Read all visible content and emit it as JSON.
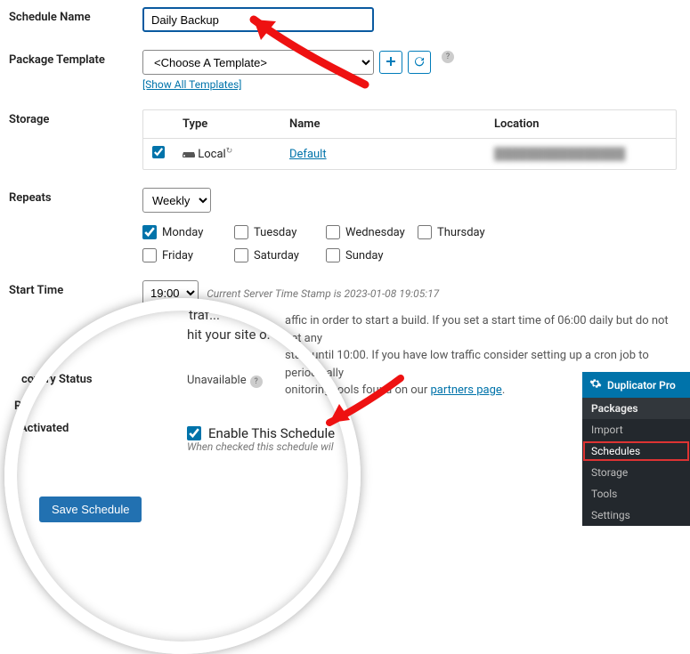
{
  "labels": {
    "scheduleName": "Schedule Name",
    "packageTemplate": "Package Template",
    "storage": "Storage",
    "repeats": "Repeats",
    "startTime": "Start Time",
    "recoveryStatus": "covery Status",
    "recoveryPrefix": "R",
    "activated": "Activated"
  },
  "scheduleName": {
    "value": "Daily Backup"
  },
  "template": {
    "placeholder": "<Choose A Template>",
    "showAll": "[Show All Templates]"
  },
  "storage": {
    "headers": {
      "type": "Type",
      "name": "Name",
      "location": "Location"
    },
    "rows": [
      {
        "checked": true,
        "typeIcon": "drive-icon",
        "typeLabel": "Local",
        "name": "Default",
        "location": "████████████████"
      }
    ]
  },
  "repeats": {
    "selected": "Weekly",
    "days": [
      {
        "label": "Monday",
        "checked": true
      },
      {
        "label": "Tuesday",
        "checked": false
      },
      {
        "label": "Wednesday",
        "checked": false
      },
      {
        "label": "Thursday",
        "checked": false
      },
      {
        "label": "Friday",
        "checked": false
      },
      {
        "label": "Saturday",
        "checked": false
      },
      {
        "label": "Sunday",
        "checked": false
      }
    ]
  },
  "startTime": {
    "selected": "19:00",
    "serverStamp": "Current Server Time Stamp is  2023-01-08 19:05:17",
    "fragmentTop": "traf...",
    "fragmentHit": "hit your site o.",
    "note1": "affic in order to start a build. If you set a start time of 06:00 daily but do not get any",
    "note2": "start until 10:00. If you have low traffic consider setting up a cron job to periodically",
    "note3": "onitoring tools found on our ",
    "partnersLink": "partners page",
    "noteEnd": "."
  },
  "recovery": {
    "status": "Unavailable"
  },
  "activated": {
    "enableLabel": "Enable This Schedule",
    "enableChecked": true,
    "hint": "When checked this schedule wil"
  },
  "buttons": {
    "save": "Save Schedule"
  },
  "panel": {
    "title": "Duplicator Pro",
    "section": "Packages",
    "items": [
      "Import",
      "Schedules",
      "Storage",
      "Tools",
      "Settings"
    ],
    "highlightIndex": 1
  },
  "colors": {
    "accent": "#0073aa",
    "red": "#d33"
  }
}
